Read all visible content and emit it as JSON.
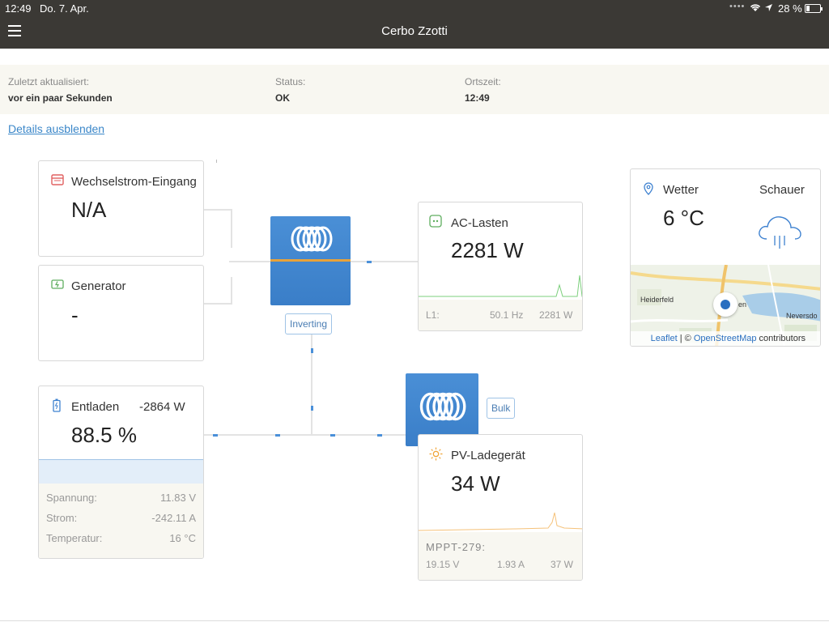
{
  "status_bar": {
    "time": "12:49",
    "date": "Do. 7. Apr.",
    "battery": "28 %",
    "battery_level": 0.28
  },
  "header": {
    "title": "Cerbo Zzotti"
  },
  "info": {
    "last_update_label": "Zuletzt aktualisiert:",
    "last_update_value": "vor ein paar Sekunden",
    "status_label": "Status:",
    "status_value": "OK",
    "local_time_label": "Ortszeit:",
    "local_time_value": "12:49"
  },
  "details_link": "Details ausblenden",
  "ac_input": {
    "title": "Wechselstrom-Eingang",
    "value": "N/A"
  },
  "generator": {
    "title": "Generator",
    "value": "-"
  },
  "inverter": {
    "badge": "Inverting"
  },
  "ac_loads": {
    "title": "AC-Lasten",
    "value": "2281 W",
    "phase": "L1:",
    "frequency": "50.1 Hz",
    "power": "2281 W"
  },
  "battery": {
    "title": "Entladen",
    "power": "-2864 W",
    "soc": "88.5 %",
    "voltage_label": "Spannung:",
    "voltage": "11.83 V",
    "current_label": "Strom:",
    "current": "-242.11 A",
    "temp_label": "Temperatur:",
    "temp": "16 °C"
  },
  "charger": {
    "badge": "Bulk"
  },
  "pv": {
    "title": "PV-Ladegerät",
    "value": "34 W",
    "device": "MPPT-279:",
    "voltage": "19.15 V",
    "current": "1.93 A",
    "power": "37 W"
  },
  "weather": {
    "title": "Wetter",
    "condition": "Schauer",
    "temperature": "6 °C",
    "map_label_1": "Heiderfeld",
    "map_label_2": "Neversdo",
    "map_label_3": "en",
    "attribution_leaflet": "Leaflet",
    "attribution_sep": " | © ",
    "attribution_osm": "OpenStreetMap",
    "attribution_tail": " contributors"
  },
  "colors": {
    "accent": "#3f82d0",
    "link": "#3b87c9",
    "loads_green": "#4caf50",
    "pv_orange": "#f5a623",
    "bar": "#3b3935"
  }
}
